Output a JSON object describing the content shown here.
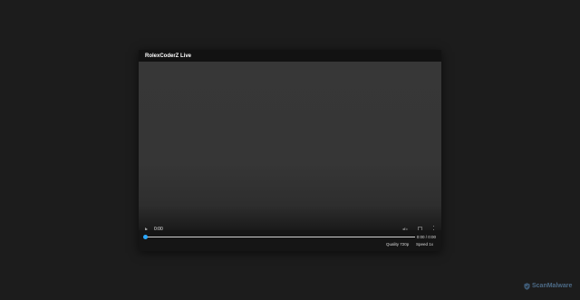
{
  "player": {
    "title": "RolexCoderZ Live"
  },
  "native_controls": {
    "current_time": "0:00",
    "play_icon": "play-icon",
    "mute_icon": "volume-muted-icon",
    "fullscreen_icon": "fullscreen-icon",
    "more_icon": "more-vertical-icon"
  },
  "custom_controls": {
    "time_readout": "0:00 / 0:00",
    "seek_progress": 0,
    "quality_label": "Quality 720p",
    "speed_label": "Speed 1x",
    "accent_color": "#2aa8ff"
  },
  "watermark": {
    "text": "ScanMalware"
  }
}
